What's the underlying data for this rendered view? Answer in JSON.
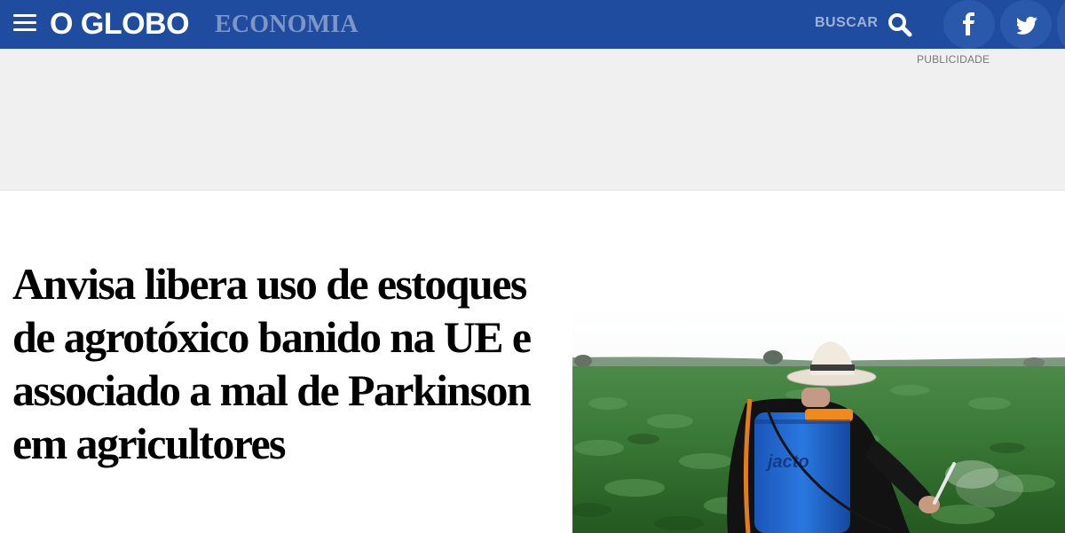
{
  "header": {
    "logo": "O GLOBO",
    "section": "ECONOMIA",
    "search_label": "BUSCAR",
    "icons": [
      "menu-icon",
      "search-icon",
      "facebook-icon",
      "twitter-icon"
    ],
    "colors": {
      "bar": "#1f4c9e",
      "section_text": "#7f95c4"
    }
  },
  "ad": {
    "label": "PUBLICIDADE"
  },
  "article": {
    "headline": "Anvisa libera uso de estoques de agrotóxico banido na UE e associado a mal de Parkinson em agricultores"
  },
  "photo": {
    "sprayer_brand": "jacto"
  }
}
